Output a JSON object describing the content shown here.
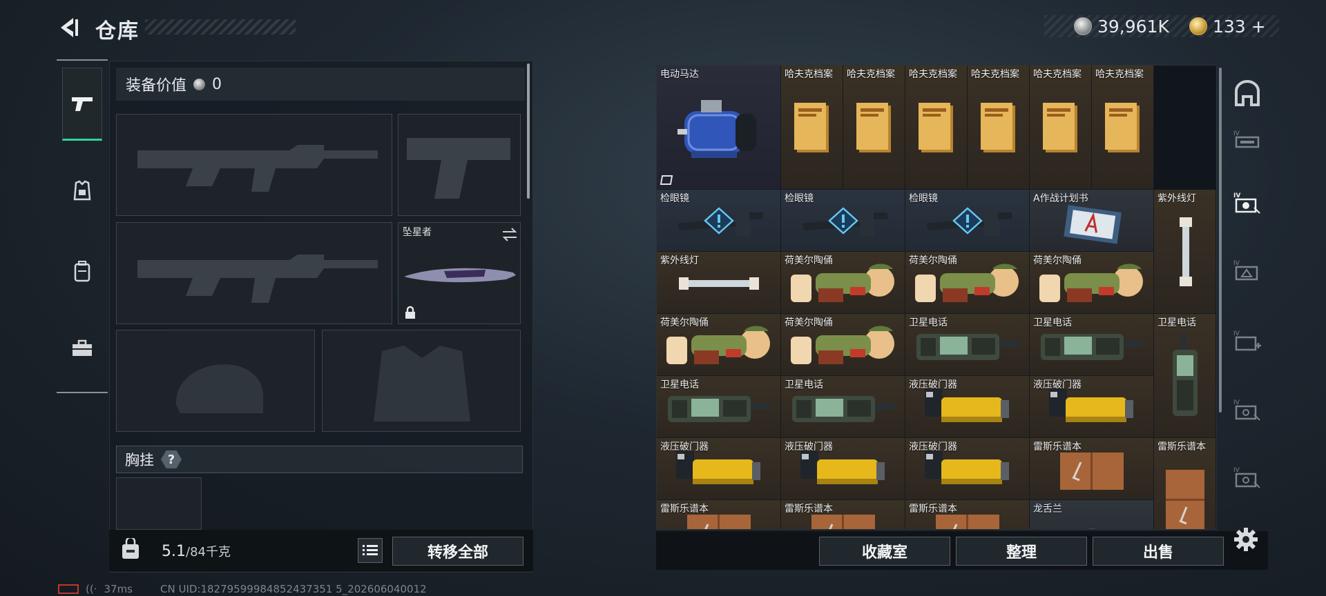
{
  "header": {
    "title": "仓库"
  },
  "currency": {
    "silver": "39,961K",
    "gold": "133",
    "gold_plus": "+"
  },
  "equipment": {
    "value_label": "装备价值",
    "value": "0",
    "melee_slot_name": "坠星者",
    "chest_rig_label": "胸挂",
    "chest_rig_help": "?"
  },
  "inventory_footer": {
    "weight_current": "5.1",
    "weight_max": "/84千克",
    "transfer_all": "转移全部"
  },
  "stash": {
    "items": [
      {
        "name": "电动马达",
        "icon": "electric-motor",
        "rarity": "purple"
      },
      {
        "name": "哈夫克档案",
        "icon": "haavk-dossier",
        "rarity": "gold"
      },
      {
        "name": "哈夫克档案",
        "icon": "haavk-dossier",
        "rarity": "gold"
      },
      {
        "name": "哈夫克档案",
        "icon": "haavk-dossier",
        "rarity": "gold"
      },
      {
        "name": "哈夫克档案",
        "icon": "haavk-dossier",
        "rarity": "gold"
      },
      {
        "name": "哈夫克档案",
        "icon": "haavk-dossier",
        "rarity": "gold"
      },
      {
        "name": "哈夫克档案",
        "icon": "haavk-dossier",
        "rarity": "gold"
      },
      {
        "name": "检眼镜",
        "icon": "ophthalmoscope",
        "rarity": "dark"
      },
      {
        "name": "检眼镜",
        "icon": "ophthalmoscope",
        "rarity": "dark"
      },
      {
        "name": "检眼镜",
        "icon": "ophthalmoscope",
        "rarity": "dark"
      },
      {
        "name": "A作战计划书",
        "icon": "battle-plan",
        "rarity": "gray"
      },
      {
        "name": "紫外线灯",
        "icon": "uv-lamp",
        "rarity": "gold"
      },
      {
        "name": "紫外线灯",
        "icon": "uv-lamp",
        "rarity": "gold"
      },
      {
        "name": "荷美尔陶俑",
        "icon": "ceramic-figurine",
        "rarity": "gold"
      },
      {
        "name": "荷美尔陶俑",
        "icon": "ceramic-figurine",
        "rarity": "gold"
      },
      {
        "name": "荷美尔陶俑",
        "icon": "ceramic-figurine",
        "rarity": "gold"
      },
      {
        "name": "荷美尔陶俑",
        "icon": "ceramic-figurine",
        "rarity": "gold"
      },
      {
        "name": "荷美尔陶俑",
        "icon": "ceramic-figurine",
        "rarity": "gold"
      },
      {
        "name": "卫星电话",
        "icon": "satellite-phone",
        "rarity": "gold"
      },
      {
        "name": "卫星电话",
        "icon": "satellite-phone",
        "rarity": "gold"
      },
      {
        "name": "卫星电话",
        "icon": "satellite-phone",
        "rarity": "gold"
      },
      {
        "name": "卫星电话",
        "icon": "satellite-phone",
        "rarity": "gold"
      },
      {
        "name": "卫星电话",
        "icon": "satellite-phone",
        "rarity": "gold"
      },
      {
        "name": "液压破门器",
        "icon": "hydraulic-breacher",
        "rarity": "gold"
      },
      {
        "name": "液压破门器",
        "icon": "hydraulic-breacher",
        "rarity": "gold"
      },
      {
        "name": "液压破门器",
        "icon": "hydraulic-breacher",
        "rarity": "gold"
      },
      {
        "name": "液压破门器",
        "icon": "hydraulic-breacher",
        "rarity": "gold"
      },
      {
        "name": "液压破门器",
        "icon": "hydraulic-breacher",
        "rarity": "gold"
      },
      {
        "name": "雷斯乐谱本",
        "icon": "music-score",
        "rarity": "gold"
      },
      {
        "name": "雷斯乐谱本",
        "icon": "music-score",
        "rarity": "gold"
      },
      {
        "name": "雷斯乐谱本",
        "icon": "music-score",
        "rarity": "gold"
      },
      {
        "name": "雷斯乐谱本",
        "icon": "music-score",
        "rarity": "gold"
      },
      {
        "name": "雷斯乐谱本",
        "icon": "music-score",
        "rarity": "gold"
      },
      {
        "name": "龙舌兰",
        "icon": "tequila",
        "rarity": "gray"
      }
    ]
  },
  "stash_footer": {
    "collection": "收藏室",
    "organize": "整理",
    "sell": "出售"
  },
  "status": {
    "ping": "37ms",
    "uid": "CN UID:18279599984852437351 5_202606040012"
  }
}
